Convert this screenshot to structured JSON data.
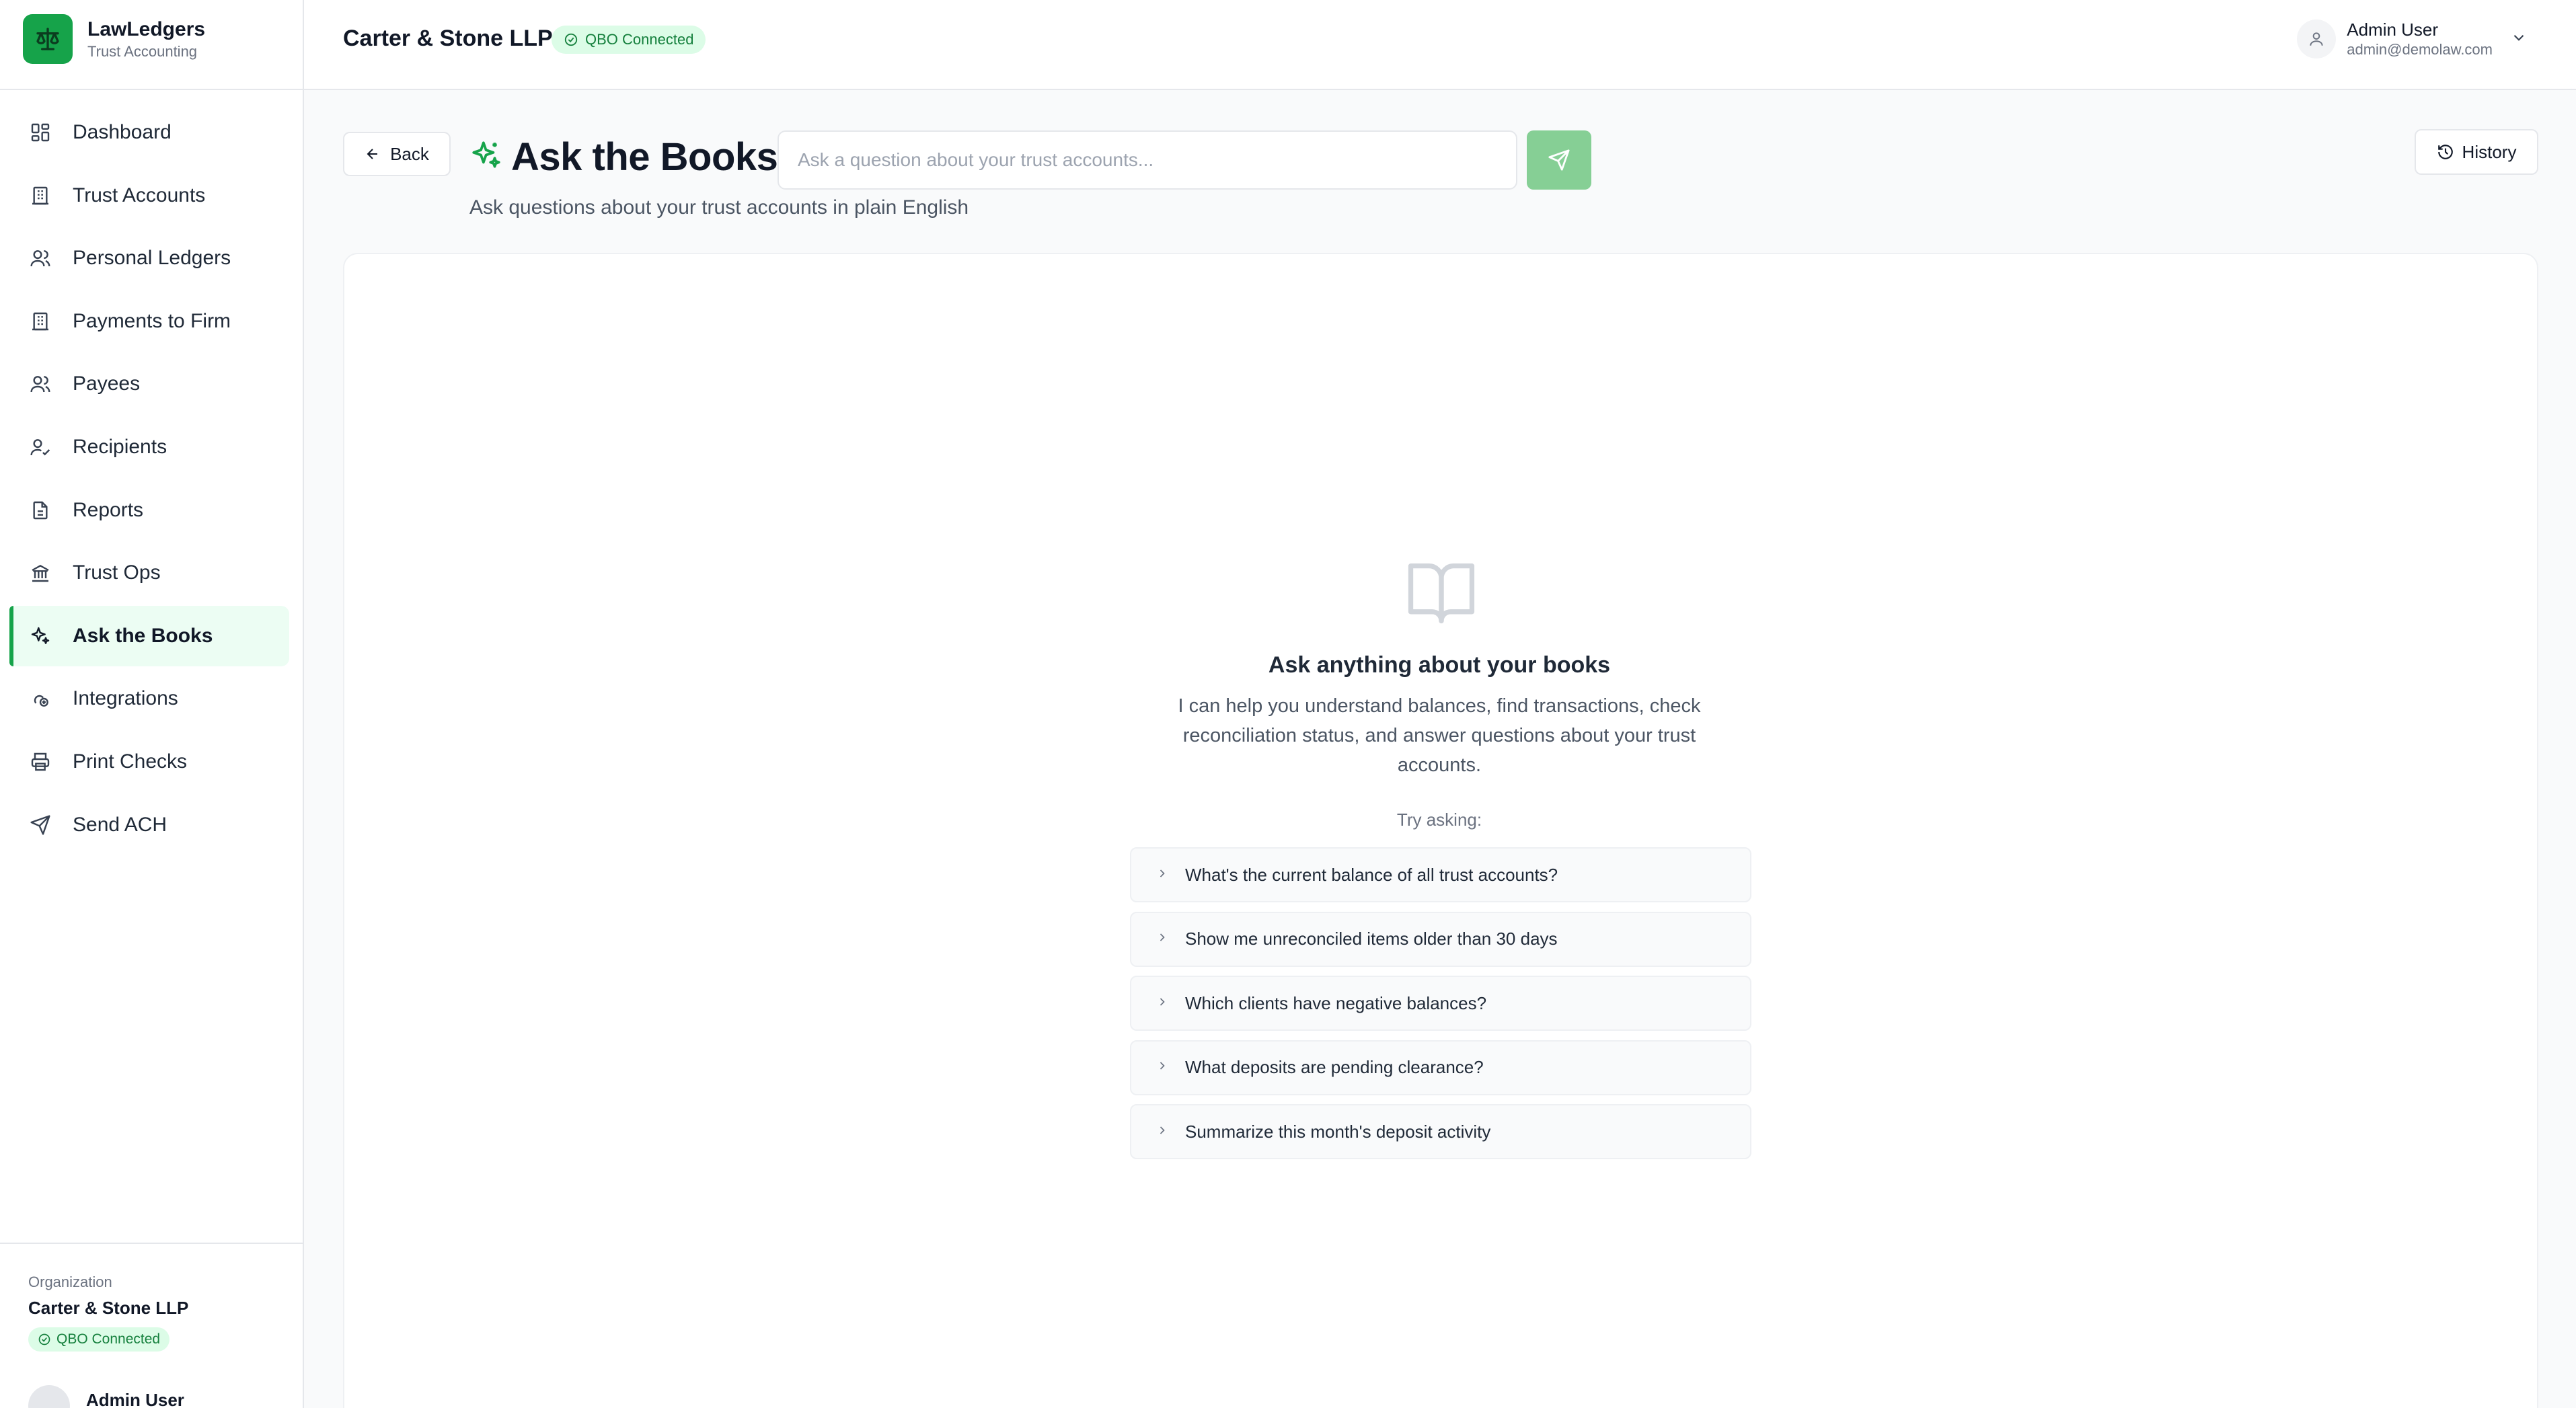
{
  "brand": {
    "name": "LawLedgers",
    "subtitle": "Trust Accounting"
  },
  "nav": [
    {
      "id": "dashboard",
      "label": "Dashboard",
      "icon": "dashboard-icon"
    },
    {
      "id": "trust-accounts",
      "label": "Trust Accounts",
      "icon": "building-icon"
    },
    {
      "id": "personal-ledgers",
      "label": "Personal Ledgers",
      "icon": "users-icon"
    },
    {
      "id": "payments-to-firm",
      "label": "Payments to Firm",
      "icon": "building-icon"
    },
    {
      "id": "payees",
      "label": "Payees",
      "icon": "users-icon"
    },
    {
      "id": "recipients",
      "label": "Recipients",
      "icon": "user-check-icon"
    },
    {
      "id": "reports",
      "label": "Reports",
      "icon": "file-icon"
    },
    {
      "id": "trust-ops",
      "label": "Trust Ops",
      "icon": "bank-icon"
    },
    {
      "id": "ask-the-books",
      "label": "Ask the Books",
      "icon": "sparkles-icon",
      "active": true
    },
    {
      "id": "integrations",
      "label": "Integrations",
      "icon": "integrations-icon"
    },
    {
      "id": "print-checks",
      "label": "Print Checks",
      "icon": "printer-icon"
    },
    {
      "id": "send-ach",
      "label": "Send ACH",
      "icon": "send-icon"
    }
  ],
  "organization": {
    "label": "Organization",
    "name": "Carter & Stone LLP",
    "status": "QBO Connected"
  },
  "sidebar_user": {
    "name": "Admin User"
  },
  "header": {
    "firm": "Carter & Stone LLP",
    "status": "QBO Connected",
    "user_name": "Admin User",
    "user_email": "admin@demolaw.com"
  },
  "page": {
    "back_label": "Back",
    "title": "Ask the Books",
    "subtitle": "Ask questions about your trust accounts in plain English",
    "input_placeholder": "Ask a question about your trust accounts...",
    "input_value": "",
    "history_label": "History"
  },
  "empty_state": {
    "icon": "book-open-icon",
    "title": "Ask anything about your books",
    "description": "I can help you understand balances, find transactions, check reconciliation status, and answer questions about your trust accounts.",
    "try_label": "Try asking:",
    "suggestions": [
      "What's the current balance of all trust accounts?",
      "Show me unreconciled items older than 30 days",
      "Which clients have negative balances?",
      "What deposits are pending clearance?",
      "Summarize this month's deposit activity"
    ]
  },
  "colors": {
    "accent": "#16a34a",
    "accent_light": "#ecfdf3",
    "badge_bg": "#dcfce7",
    "send_button": "#86cf95"
  }
}
